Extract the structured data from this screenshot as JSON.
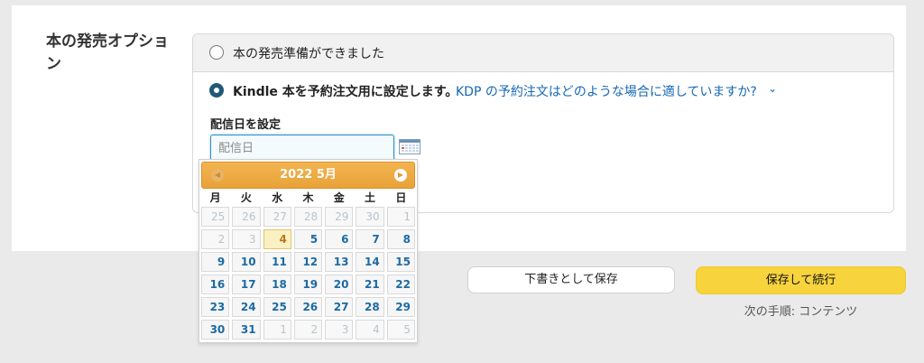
{
  "section": {
    "title": "本の発売オプション"
  },
  "options": {
    "ready": {
      "label": "本の発売準備ができました",
      "selected": false
    },
    "preorder": {
      "label": "Kindle 本を予約注文用に設定します。",
      "selected": true,
      "help_link": "KDP の予約注文はどのような場合に適していますか?",
      "help_chevron": "⌄"
    }
  },
  "delivery_date": {
    "label": "配信日を設定",
    "placeholder": "配信日",
    "value": ""
  },
  "calendar": {
    "title": "2022 5月",
    "prev_icon": "◀",
    "next_icon": "▶",
    "weekdays": [
      "月",
      "火",
      "水",
      "木",
      "金",
      "土",
      "日"
    ],
    "weeks": [
      [
        "25",
        "26",
        "27",
        "28",
        "29",
        "30",
        "1"
      ],
      [
        "2",
        "3",
        "4",
        "5",
        "6",
        "7",
        "8"
      ],
      [
        "9",
        "10",
        "11",
        "12",
        "13",
        "14",
        "15"
      ],
      [
        "16",
        "17",
        "18",
        "19",
        "20",
        "21",
        "22"
      ],
      [
        "23",
        "24",
        "25",
        "26",
        "27",
        "28",
        "29"
      ],
      [
        "30",
        "31",
        "1",
        "2",
        "3",
        "4",
        "5"
      ]
    ],
    "today": "4",
    "other_month_cells": [
      [
        0,
        0
      ],
      [
        0,
        1
      ],
      [
        0,
        2
      ],
      [
        0,
        3
      ],
      [
        0,
        4
      ],
      [
        0,
        5
      ],
      [
        0,
        6
      ],
      [
        1,
        0
      ],
      [
        1,
        1
      ],
      [
        5,
        2
      ],
      [
        5,
        3
      ],
      [
        5,
        4
      ],
      [
        5,
        5
      ],
      [
        5,
        6
      ]
    ]
  },
  "actions": {
    "save_draft": "下書きとして保存",
    "save_continue": "保存して続行",
    "next_step": "次の手順: コンテンツ"
  },
  "colors": {
    "accent_blue": "#1e5a78",
    "link_blue": "#1667b5",
    "save_yellow": "#f7d33d",
    "calendar_orange": "#e9a23a"
  }
}
